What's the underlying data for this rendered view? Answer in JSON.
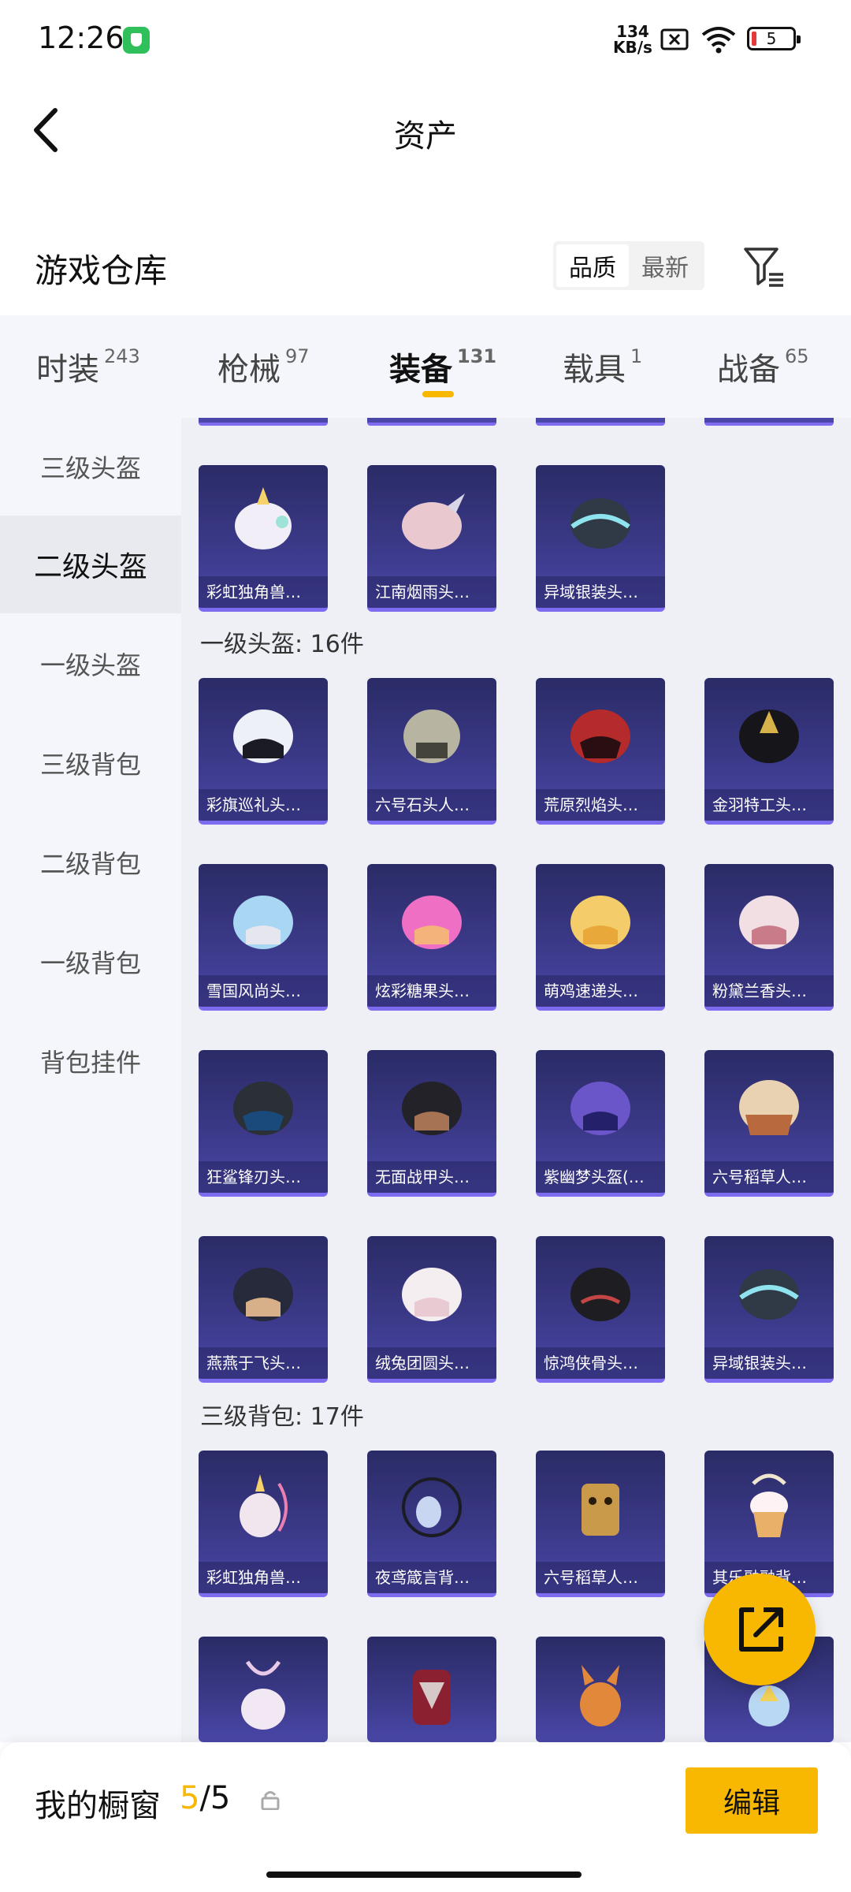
{
  "status_bar": {
    "time": "12:26",
    "speed_value": "134",
    "speed_unit": "KB/s",
    "battery": "5"
  },
  "nav": {
    "title": "资产"
  },
  "warehouse": {
    "title": "游戏仓库",
    "sort_options": [
      "品质",
      "最新"
    ],
    "sort_active": "品质"
  },
  "tabs": [
    {
      "label": "时装",
      "count": "243"
    },
    {
      "label": "枪械",
      "count": "97"
    },
    {
      "label": "装备",
      "count": "131"
    },
    {
      "label": "载具",
      "count": "1"
    },
    {
      "label": "战备",
      "count": "65"
    }
  ],
  "sidebar": {
    "items": [
      "三级头盔",
      "二级头盔",
      "一级头盔",
      "三级背包",
      "二级背包",
      "一级背包",
      "背包挂件"
    ],
    "active": "二级头盔"
  },
  "sections": {
    "level2_helmets": [
      "彩虹独角兽…",
      "江南烟雨头…",
      "异域银装头…"
    ],
    "level1_title": "一级头盔: 16件",
    "level1_helmets": [
      "彩旗巡礼头…",
      "六号石头人…",
      "荒原烈焰头…",
      "金羽特工头…",
      "雪国风尚头…",
      "炫彩糖果头…",
      "萌鸡速递头…",
      "粉黛兰香头…",
      "狂鲨锋刃头…",
      "无面战甲头…",
      "紫幽梦头盔(…",
      "六号稻草人…",
      "燕燕于飞头…",
      "绒兔团圆头…",
      "惊鸿侠骨头…",
      "异域银装头…"
    ],
    "level3_backpacks_title": "三级背包: 17件",
    "level3_backpacks": [
      "彩虹独角兽…",
      "夜鸢箴言背…",
      "六号稻草人…",
      "其乐融融背…"
    ]
  },
  "bottom_bar": {
    "label": "我的橱窗",
    "count_current": "5",
    "count_total": "/5",
    "edit_label": "编辑"
  },
  "colors": {
    "accent": "#f8b700",
    "card_bg": "#3c3a8a",
    "card_border": "#7d6cf0"
  }
}
